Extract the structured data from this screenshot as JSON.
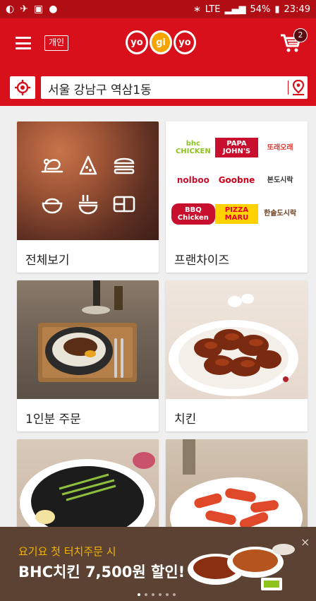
{
  "status_bar": {
    "battery_percent": "54%",
    "time": "23:49",
    "network": "LTE"
  },
  "header": {
    "account_label": "개인",
    "logo_syllables": [
      "yo",
      "gi",
      "yo"
    ],
    "cart_count": "2"
  },
  "search": {
    "address": "서울 강남구 역삼1동"
  },
  "categories": [
    {
      "label": "전체보기"
    },
    {
      "label": "프랜차이즈"
    },
    {
      "label": "1인분 주문"
    },
    {
      "label": "치킨"
    },
    {
      "label": ""
    },
    {
      "label": ""
    }
  ],
  "franchise_brands": [
    {
      "name": "bhc CHICKEN",
      "color": "#8dc21f"
    },
    {
      "name": "PAPA JOHN'S",
      "color": "#c8102e"
    },
    {
      "name": "또래오래",
      "color": "#e03a2f"
    },
    {
      "name": "nolboo",
      "color": "#c8102e"
    },
    {
      "name": "Goobne",
      "color": "#d0021b"
    },
    {
      "name": "본도시락",
      "color": "#333333"
    },
    {
      "name": "BBQ Chicken",
      "color": "#c8102e"
    },
    {
      "name": "PIZZA MARU",
      "color": "#e4002b"
    },
    {
      "name": "한솥도시락",
      "color": "#6b3f1e"
    }
  ],
  "promo": {
    "subtitle": "요기요 첫 터치주문 시",
    "title": "BHC치킨 7,500원 할인!",
    "close": "×",
    "page_dots": 6,
    "active_dot": 0
  },
  "colors": {
    "brand_red": "#d7101c",
    "status_red": "#b00d14",
    "promo_bg": "#5b4232",
    "promo_accent": "#f5b400"
  }
}
